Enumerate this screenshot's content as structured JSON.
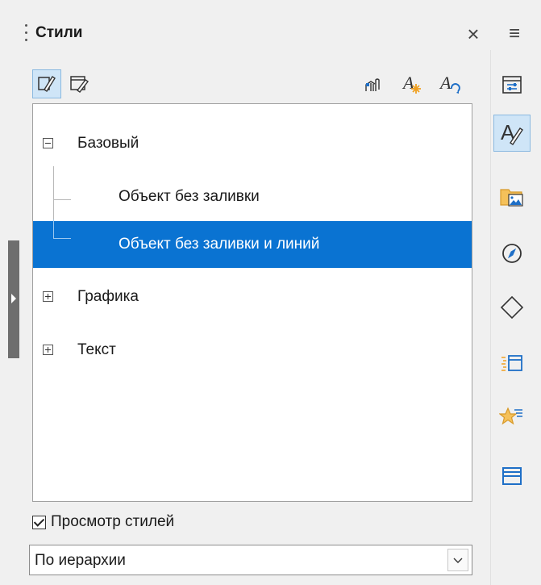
{
  "panel": {
    "title": "Стили"
  },
  "toolbar": {
    "left": [
      "paragraph-styles-icon",
      "frame-styles-icon"
    ],
    "right": [
      "fill-format-mode-icon",
      "new-style-icon",
      "update-style-icon"
    ]
  },
  "tree": {
    "items": [
      {
        "label": "Базовый",
        "level": 0,
        "expanded": true
      },
      {
        "label": "Объект без заливки",
        "level": 1
      },
      {
        "label": "Объект без заливки и линий",
        "level": 1,
        "selected": true
      },
      {
        "label": "Графика",
        "level": 0,
        "expanded": false
      },
      {
        "label": "Текст",
        "level": 0,
        "expanded": false
      }
    ]
  },
  "preview": {
    "label": "Просмотр стилей",
    "checked": true
  },
  "filter": {
    "value": "По иерархии"
  },
  "sidebar": {
    "buttons": [
      "properties-icon",
      "styles-icon",
      "gallery-icon",
      "navigator-icon",
      "shapes-icon",
      "master-slides-icon",
      "animation-icon",
      "slide-transition-icon"
    ]
  },
  "colors": {
    "selection": "#0a73d2",
    "accent": "#1e6fc7",
    "orange": "#f0a020"
  }
}
